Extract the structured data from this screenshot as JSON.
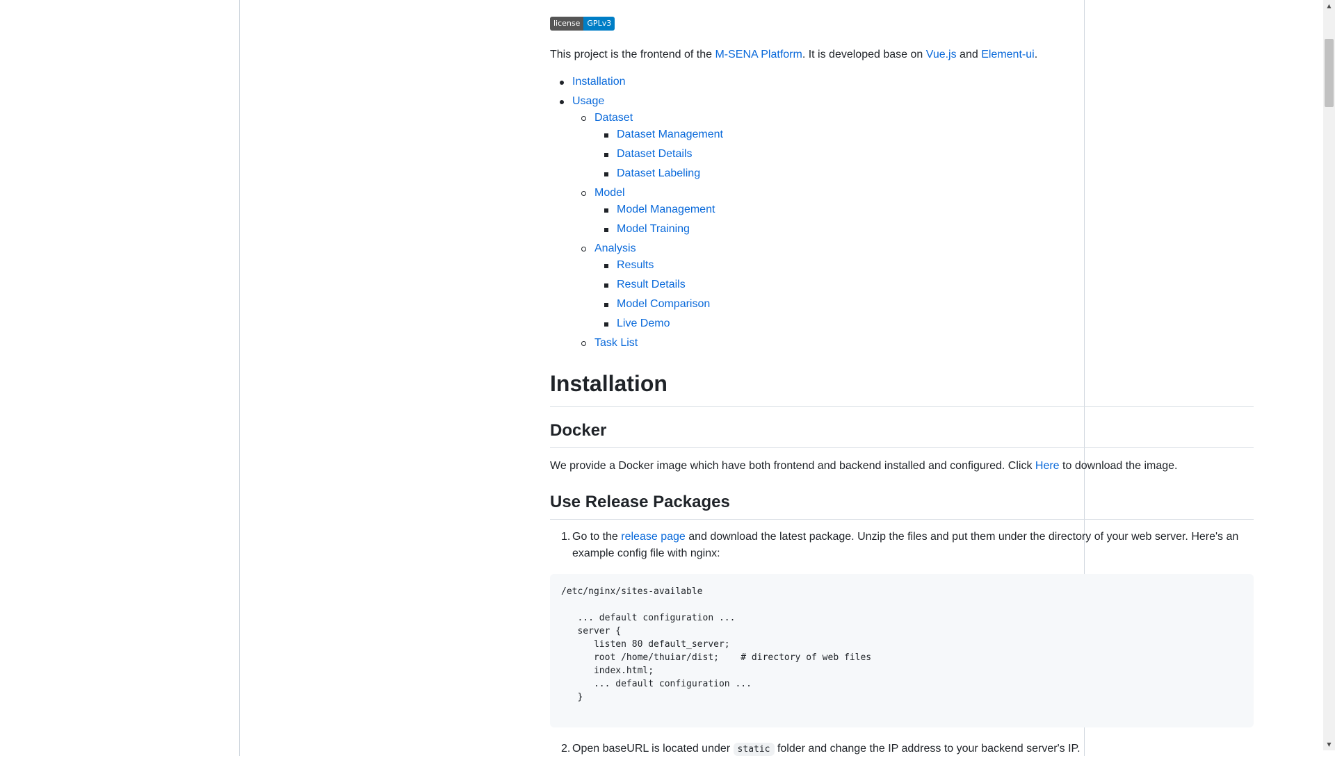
{
  "badge": {
    "label": "license",
    "value": "GPLv3"
  },
  "intro": {
    "prefix": "This project is the frontend of the ",
    "link1": "M-SENA Platform",
    "mid1": ". It is developed base on ",
    "link2": "Vue.js",
    "mid2": " and ",
    "link3": "Element-ui",
    "suffix": "."
  },
  "toc": {
    "installation": "Installation",
    "usage": "Usage",
    "dataset": "Dataset",
    "dataset_items": [
      "Dataset Management",
      "Dataset Details",
      "Dataset Labeling"
    ],
    "model": "Model",
    "model_items": [
      "Model Management",
      "Model Training"
    ],
    "analysis": "Analysis",
    "analysis_items": [
      "Results",
      "Result Details",
      "Model Comparison",
      "Live Demo"
    ],
    "task_list": "Task List"
  },
  "installation": {
    "heading": "Installation",
    "docker_heading": "Docker",
    "docker_text_prefix": "We provide a Docker image which have both frontend and backend installed and configured. Click ",
    "docker_link": "Here",
    "docker_text_suffix": " to download the image.",
    "release_heading": "Use Release Packages",
    "step1_num": "1.",
    "step1_prefix": "Go to the ",
    "step1_link": "release page",
    "step1_suffix": " and download the latest package. Unzip the files and put them under the directory of your web server. Here's an example config file with nginx:",
    "code": "/etc/nginx/sites-available\n\n   ... default configuration ...\n   server {\n      listen 80 default_server;\n      root /home/thuiar/dist;    # directory of web files\n      index.html;\n      ... default configuration ...\n   }",
    "step2_num": "2.",
    "step2_prefix": "Open baseURL is located under ",
    "step2_code": "static",
    "step2_suffix": " folder and change the IP address to your backend server's IP."
  },
  "scrollbar": {
    "up": "▲",
    "down": "▼"
  }
}
